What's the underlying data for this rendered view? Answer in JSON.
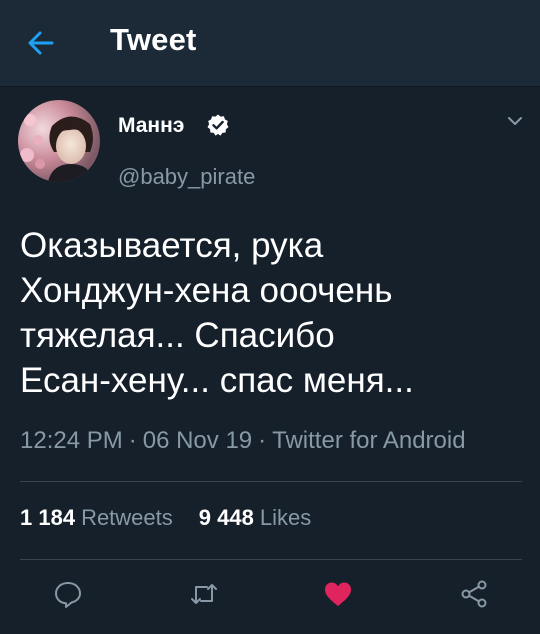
{
  "header": {
    "title": "Tweet",
    "back_icon": "arrow-left-icon"
  },
  "author": {
    "name": "Маннэ",
    "handle": "@baby_pirate",
    "verified": true,
    "verified_icon": "verified-badge-icon"
  },
  "tweet": {
    "lines": [
      "Оказывается, рука",
      "Хонджун-хена ооочень",
      "тяжелая... Спасибо",
      "Есан-хену... спас меня..."
    ],
    "time": "12:24 PM",
    "date": "06 Nov 19",
    "separator": "·",
    "source": "Twitter for Android"
  },
  "stats": {
    "retweets_count": "1 184",
    "retweets_label": "Retweets",
    "likes_count": "9 448",
    "likes_label": "Likes"
  },
  "actions": [
    {
      "name": "reply",
      "icon": "reply-icon"
    },
    {
      "name": "retweet",
      "icon": "retweet-icon"
    },
    {
      "name": "like",
      "icon": "heart-icon",
      "active": true
    },
    {
      "name": "share",
      "icon": "share-icon"
    }
  ],
  "colors": {
    "background": "#15202b",
    "header_background": "#1c2a38",
    "accent": "#1da1f2",
    "secondary_text": "#8899a6",
    "like_active": "#e0245e",
    "divider": "#38444d"
  }
}
